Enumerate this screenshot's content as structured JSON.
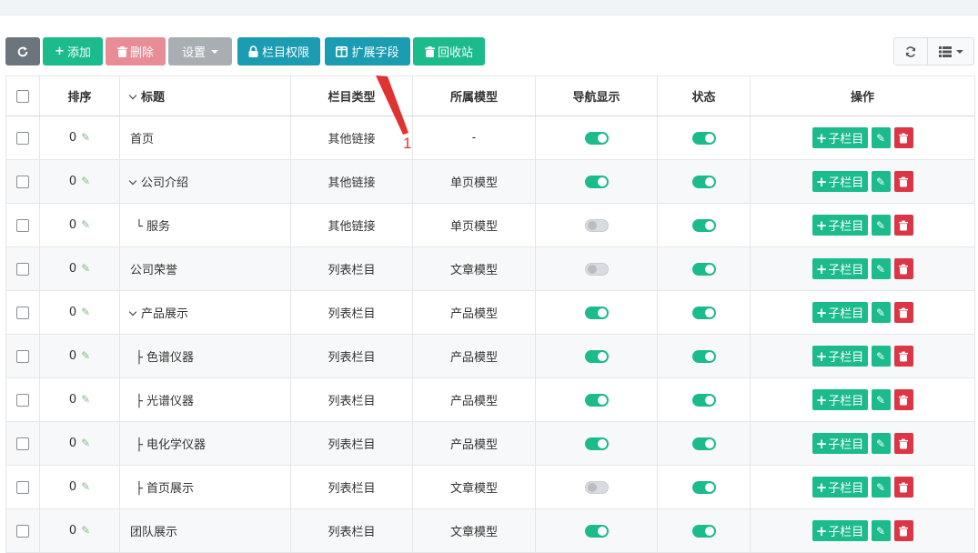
{
  "toolbar": {
    "refresh_icon": "refresh-icon",
    "add_label": "添加",
    "delete_label": "删除",
    "settings_label": "设置",
    "permission_label": "栏目权限",
    "extend_label": "扩展字段",
    "recycle_label": "回收站"
  },
  "table": {
    "headers": {
      "sort": "排序",
      "title": "标题",
      "type": "栏目类型",
      "model": "所属模型",
      "nav": "导航显示",
      "status": "状态",
      "actions": "操作"
    },
    "action_label": "子栏目",
    "rows": [
      {
        "sort": "0",
        "title": "首页",
        "prefix": "",
        "type": "其他链接",
        "model": "-",
        "nav": true,
        "status": true
      },
      {
        "sort": "0",
        "title": "公司介绍",
        "prefix": "chevron",
        "type": "其他链接",
        "model": "单页模型",
        "nav": true,
        "status": true
      },
      {
        "sort": "0",
        "title": "服务",
        "prefix": "└ ",
        "type": "其他链接",
        "model": "单页模型",
        "nav": false,
        "status": true
      },
      {
        "sort": "0",
        "title": "公司荣誉",
        "prefix": "",
        "type": "列表栏目",
        "model": "文章模型",
        "nav": false,
        "status": true
      },
      {
        "sort": "0",
        "title": "产品展示",
        "prefix": "chevron",
        "type": "列表栏目",
        "model": "产品模型",
        "nav": true,
        "status": true
      },
      {
        "sort": "0",
        "title": "色谱仪器",
        "prefix": "├ ",
        "type": "列表栏目",
        "model": "产品模型",
        "nav": true,
        "status": true
      },
      {
        "sort": "0",
        "title": "光谱仪器",
        "prefix": "├ ",
        "type": "列表栏目",
        "model": "产品模型",
        "nav": true,
        "status": true
      },
      {
        "sort": "0",
        "title": "电化学仪器",
        "prefix": "├ ",
        "type": "列表栏目",
        "model": "产品模型",
        "nav": true,
        "status": true
      },
      {
        "sort": "0",
        "title": "首页展示",
        "prefix": "├ ",
        "type": "列表栏目",
        "model": "文章模型",
        "nav": false,
        "status": true
      },
      {
        "sort": "0",
        "title": "团队展示",
        "prefix": "",
        "type": "列表栏目",
        "model": "文章模型",
        "nav": true,
        "status": true
      }
    ]
  },
  "annotation": {
    "number": "1",
    "color": "#e13232"
  },
  "colors": {
    "primary_green": "#1cbb8c",
    "info_teal": "#1a9cb3",
    "danger_red": "#dc3545",
    "danger_light": "#e88c95",
    "secondary_gray": "#6c757d"
  }
}
